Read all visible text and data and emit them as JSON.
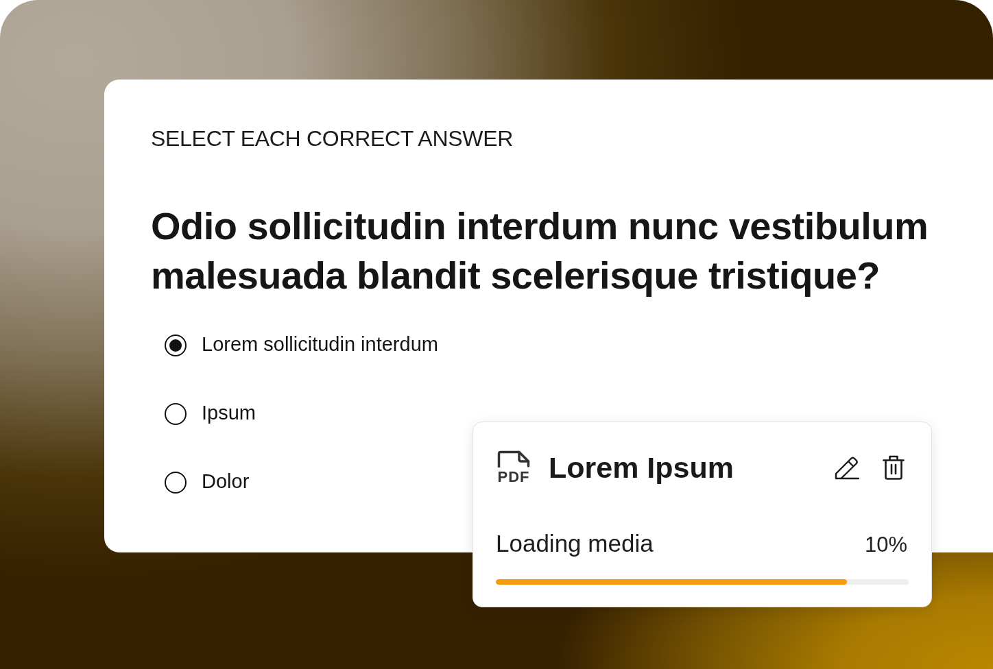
{
  "quiz": {
    "instruction": "SELECT EACH CORRECT ANSWER",
    "question": "Odio sollicitudin interdum nunc vestibulum malesuada blandit scelerisque tristique?",
    "options": [
      {
        "label": "Lorem sollicitudin interdum",
        "selected": true
      },
      {
        "label": "Ipsum",
        "selected": false
      },
      {
        "label": "Dolor",
        "selected": false
      }
    ]
  },
  "upload": {
    "file_type": "PDF",
    "title": "Lorem Ipsum",
    "status": "Loading media",
    "percent": "10%",
    "level": 0.85
  }
}
